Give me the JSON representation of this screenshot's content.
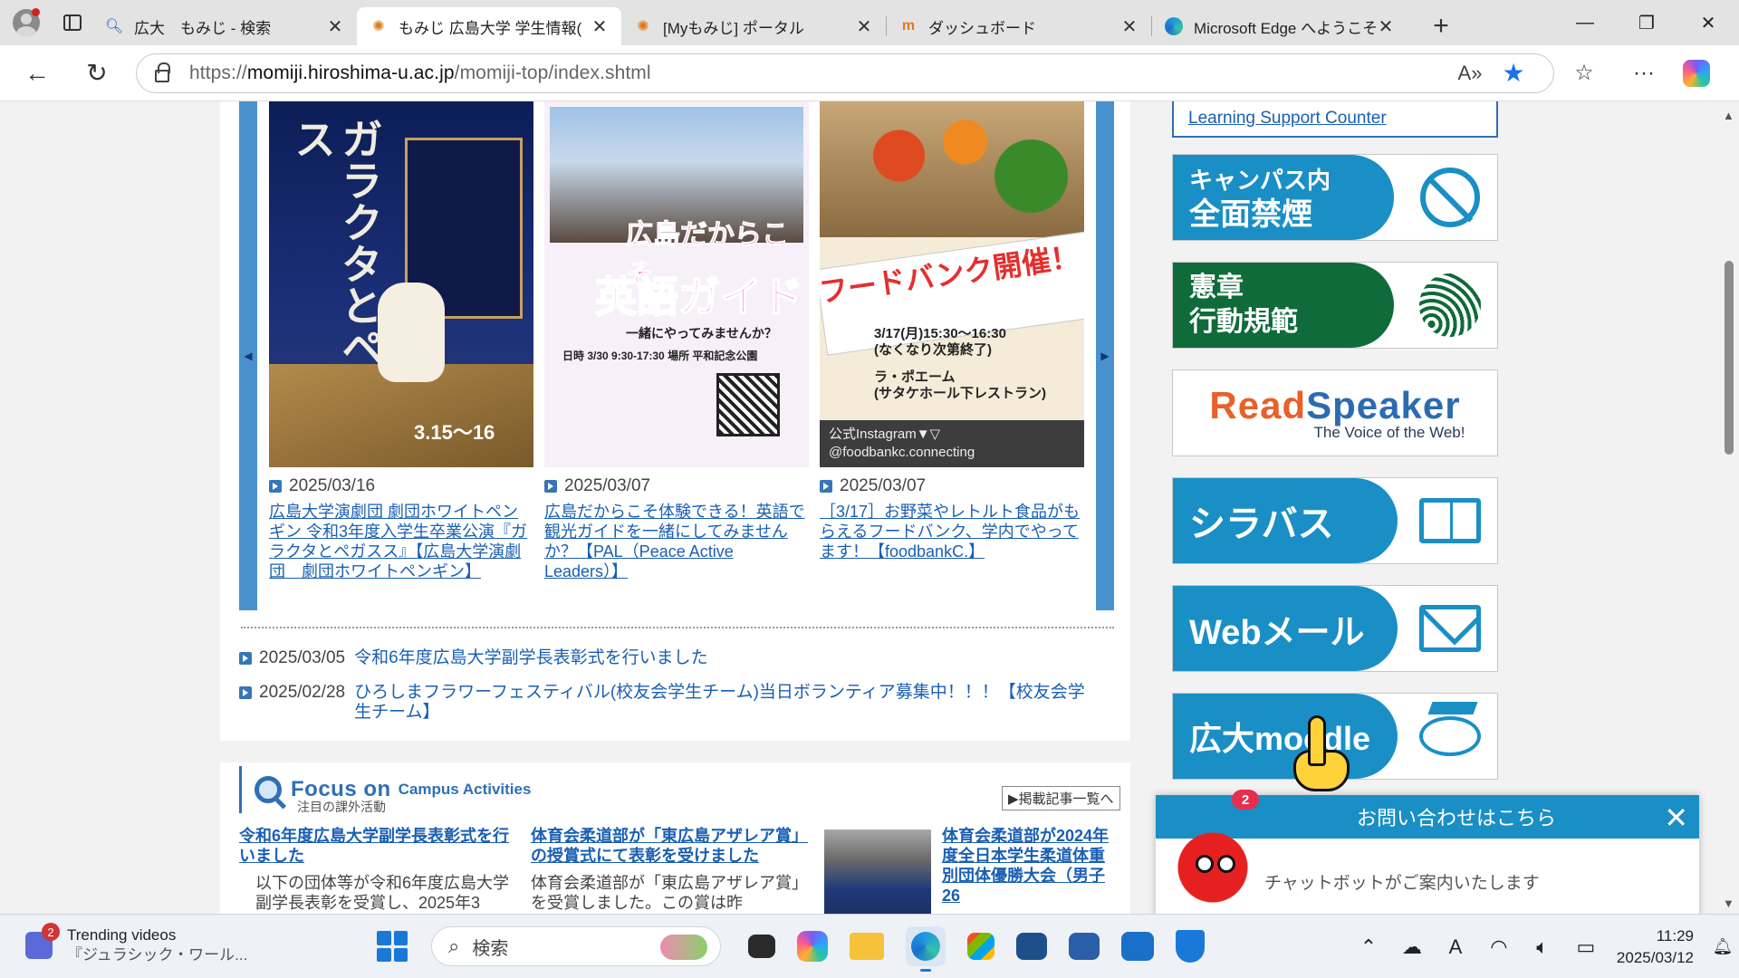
{
  "browser": {
    "tabs": [
      {
        "title": "広大　もみじ - 検索",
        "icon": "search-icon",
        "active": false
      },
      {
        "title": "もみじ 広島大学 学生情報(",
        "icon": "maple-icon",
        "active": true
      },
      {
        "title": "[Myもみじ] ポータル",
        "icon": "maple-icon",
        "active": false
      },
      {
        "title": "ダッシュボード",
        "icon": "moodle-icon",
        "active": false
      },
      {
        "title": "Microsoft Edge へようこそ",
        "icon": "edge-icon",
        "active": false
      }
    ],
    "url_prefix": "https://",
    "url_host": "momiji.hiroshima-u.ac.jp",
    "url_path": "/momiji-top/index.shtml"
  },
  "carousel": {
    "cards": [
      {
        "date": "2025/03/16",
        "link": "広島大学演劇団 劇団ホワイトペンギン 令和3年度入学生卒業公演『ガラクタとペガスス』【広島大学演劇団　劇団ホワイトペンギン】",
        "poster_title": "ガラクタとペガスス",
        "poster_dates": "3.15〜16"
      },
      {
        "date": "2025/03/07",
        "link": "広島だからこそ体験できる！英語で観光ガイドを一緒にしてみませんか？【PAL（Peace Active Leaders）】",
        "poster_head1": "広島だからこそ",
        "poster_head2": "英語ガイド",
        "poster_sub": "一緒にやってみませんか？",
        "poster_info": "日時 3/30 9:30-17:30 場所 平和記念公園"
      },
      {
        "date": "2025/03/07",
        "link": "［3/17］お野菜やレトルト食品がもらえるフードバンク、学内でやってます！【foodbankC.】",
        "poster_banner": "フードバンク開催！",
        "poster_ev1": "3/17(月)15:30〜16:30\n(なくなり次第終了)",
        "poster_ev2": "ラ・ポエーム\n(サタケホール下レストラン)",
        "poster_insta": "公式Instagram▼▽\n@foodbankc.connecting"
      }
    ]
  },
  "news": [
    {
      "date": "2025/03/05",
      "title": "令和6年度広島大学副学長表彰式を行いました"
    },
    {
      "date": "2025/02/28",
      "title": "ひろしまフラワーフェスティバル(校友会学生チーム)当日ボランティア募集中！！！【校友会学生チーム】"
    }
  ],
  "focus": {
    "title": "Focus on",
    "subtitle": "Campus Activities",
    "jp_subtitle": "注目の課外活動",
    "more_link": "▶掲載記事一覧へ",
    "articles": [
      {
        "title": "令和6年度広島大学副学長表彰式を行いました",
        "excerpt": "以下の団体等が令和6年度広島大学副学長表彰を受賞し、2025年3"
      },
      {
        "title": "体育会柔道部が「東広島アザレア賞」の授賞式にて表彰を受けました",
        "excerpt": "体育会柔道部が「東広島アザレア賞」を受賞しました。この賞は昨"
      },
      {
        "title": "体育会柔道部が2024年度全日本学生柔道体重別団体優勝大会（男子26"
      }
    ]
  },
  "sidebar": {
    "learning_support": "Learning Support Counter",
    "no_smoking": {
      "line1": "キャンパス内",
      "line2": "全面禁煙"
    },
    "charter": {
      "line1": "憲章",
      "line2": "行動規範"
    },
    "readspeaker": {
      "read": "Read",
      "speaker": "Speaker",
      "tagline": "The Voice of the Web!"
    },
    "syllabus": "シラバス",
    "webmail": "Webメール",
    "moodle": "広大moodle"
  },
  "chat": {
    "header": "お問い合わせはこちら",
    "message": "チャットボットがご案内いたします",
    "badge": "2"
  },
  "taskbar": {
    "widget_title": "Trending videos",
    "widget_sub": "『ジュラシック・ワール...",
    "widget_badge": "2",
    "search_placeholder": "検索",
    "time": "11:29",
    "date": "2025/03/12"
  }
}
